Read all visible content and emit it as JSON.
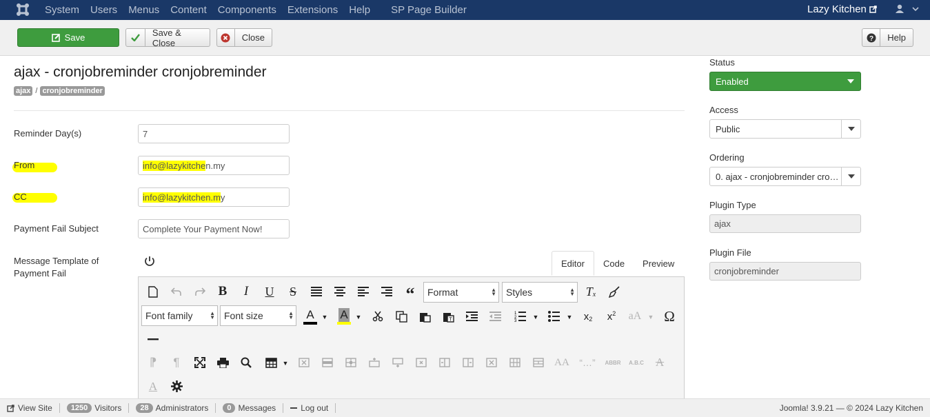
{
  "navbar": {
    "menu": [
      "System",
      "Users",
      "Menus",
      "Content",
      "Components",
      "Extensions",
      "Help"
    ],
    "extra": "SP Page Builder",
    "site_name": "Lazy Kitchen"
  },
  "toolbar": {
    "save": "Save",
    "save_close": "Save & Close",
    "close": "Close",
    "help": "Help"
  },
  "page": {
    "title": "ajax - cronjobreminder cronjobreminder",
    "breadcrumb": [
      "ajax",
      "/",
      "cronjobreminder"
    ]
  },
  "form": {
    "reminder_label": "Reminder Day(s)",
    "reminder_value": "7",
    "from_label": "From",
    "from_value_hl": "info@lazykitche",
    "from_value_rest": "n.my",
    "cc_label": "CC",
    "cc_value_hl": "info@lazykitchen.m",
    "cc_value_rest": "y",
    "subject_label": "Payment Fail Subject",
    "subject_value": "Complete Your Payment Now!",
    "template_label": "Message Template of Payment Fail"
  },
  "editor": {
    "tabs": [
      "Editor",
      "Code",
      "Preview"
    ],
    "active_tab": "Editor",
    "format": "Format",
    "styles": "Styles",
    "font_family": "Font family",
    "font_size": "Font size"
  },
  "sidebar": {
    "status_label": "Status",
    "status_value": "Enabled",
    "access_label": "Access",
    "access_value": "Public",
    "ordering_label": "Ordering",
    "ordering_value": "0. ajax - cronjobreminder cro…",
    "type_label": "Plugin Type",
    "type_value": "ajax",
    "file_label": "Plugin File",
    "file_value": "cronjobreminder"
  },
  "statusbar": {
    "view_site": "View Site",
    "visitors_count": "1250",
    "visitors": "Visitors",
    "admins_count": "28",
    "admins": "Administrators",
    "messages_count": "0",
    "messages": "Messages",
    "logout": "Log out",
    "version": "Joomla! 3.9.21  —  © 2024 Lazy Kitchen"
  },
  "colors": {
    "navbar": "#1a3867",
    "save_green": "#3e9c3e",
    "highlight": "#ffff00"
  }
}
